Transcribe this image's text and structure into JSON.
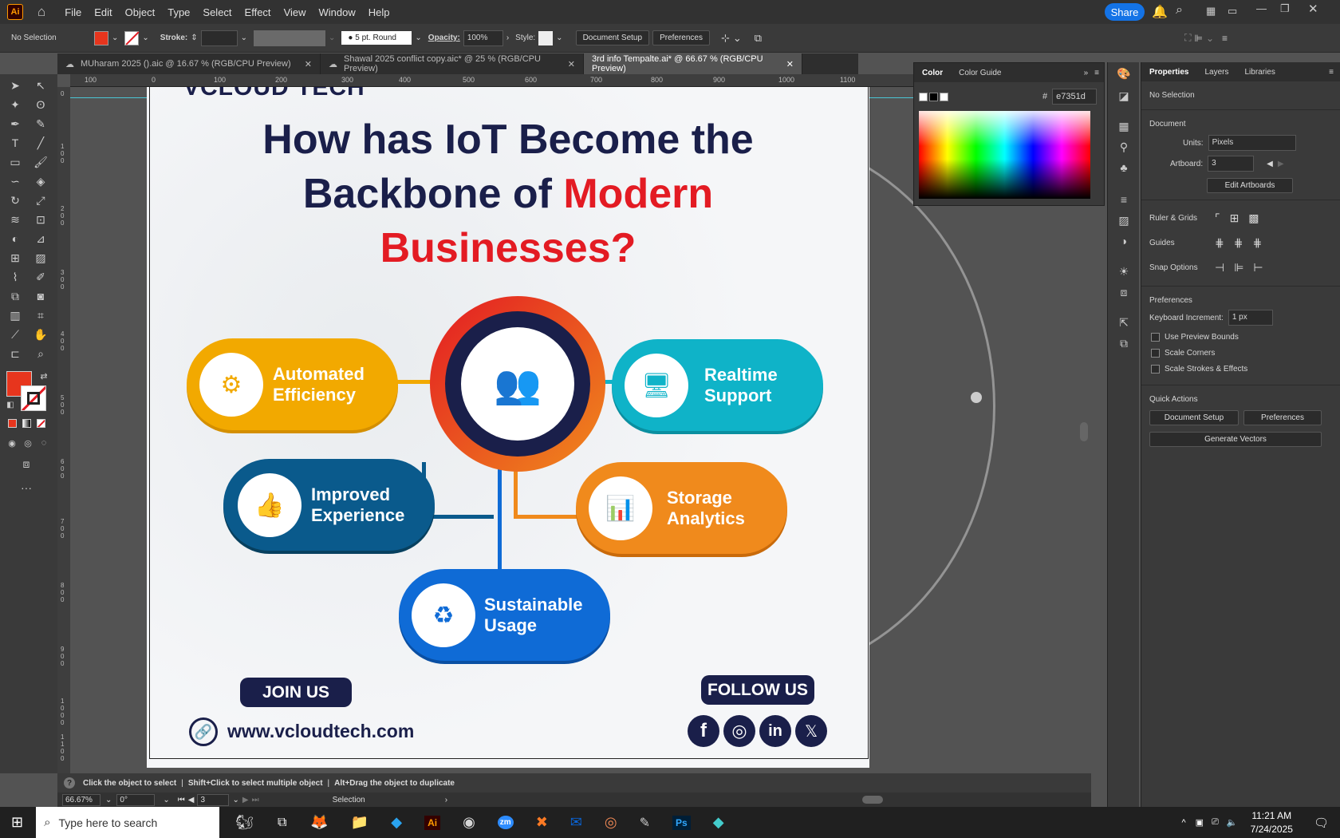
{
  "app": {
    "logo": "Ai",
    "menus": [
      "File",
      "Edit",
      "Object",
      "Type",
      "Select",
      "Effect",
      "View",
      "Window",
      "Help"
    ],
    "share": "Share"
  },
  "control": {
    "selection": "No Selection",
    "stroke_label": "Stroke:",
    "brush": "5 pt. Round",
    "opacity_label": "Opacity:",
    "opacity": "100%",
    "style_label": "Style:",
    "doc_setup": "Document Setup",
    "preferences": "Preferences"
  },
  "tabs": [
    {
      "label": "MUharam 2025 ().aic @ 16.67 % (RGB/CPU Preview)"
    },
    {
      "label": "Shawal 2025 conflict copy.aic* @ 25 % (RGB/CPU Preview)"
    },
    {
      "label": "3rd info Tempalte.ai* @ 66.67 % (RGB/CPU Preview)"
    }
  ],
  "ruler": {
    "top": [
      "100",
      "0",
      "100",
      "200",
      "300",
      "400",
      "500",
      "600",
      "700",
      "800",
      "900",
      "1000",
      "1100"
    ],
    "left": [
      "0",
      "1 0 0",
      "2 0 0",
      "3 0 0",
      "4 0 0",
      "5 0 0",
      "6 0 0",
      "7 0 0",
      "8 0 0",
      "9 0 0",
      "1 0 0 0",
      "1 1 0 0"
    ]
  },
  "artboard": {
    "logo": "VCLOUD TECH",
    "title_line1": "How has IoT Become the",
    "title_line2a": "Backbone of ",
    "title_line2b": "Modern",
    "title_line3": "Businesses?",
    "items": [
      {
        "l1": "Automated",
        "l2": "Efficiency",
        "color": "#f2a900",
        "icon": "⚙"
      },
      {
        "l1": "Realtime",
        "l2": "Support",
        "color": "#0fb3c8",
        "icon": "🖥"
      },
      {
        "l1": "Improved",
        "l2": "Experience",
        "color": "#0a5a8c",
        "icon": "👍"
      },
      {
        "l1": "Storage",
        "l2": "Analytics",
        "color": "#f08a1c",
        "icon": "📊"
      },
      {
        "l1": "Sustainable",
        "l2": "Usage",
        "color": "#0f6bd6",
        "icon": "♻"
      }
    ],
    "join": "JOIN US",
    "follow": "FOLLOW US",
    "website": "www.vcloudtech.com",
    "social": [
      "f",
      "◎",
      "in",
      "𝕏"
    ],
    "accent_red": "#e31b23",
    "navy": "#1a1f4a"
  },
  "status": {
    "hint1": "Click the object to select",
    "hint2": "Shift+Click to select multiple object",
    "hint3": "Alt+Drag the object to duplicate",
    "zoom": "66.67%",
    "rotation": "0°",
    "artboard": "3",
    "tool": "Selection"
  },
  "color_panel": {
    "tab1": "Color",
    "tab2": "Color Guide",
    "hex_label": "#",
    "hex": "e7351d"
  },
  "properties": {
    "tabs": [
      "Properties",
      "Layers",
      "Libraries"
    ],
    "no_selection": "No Selection",
    "document": "Document",
    "units_label": "Units:",
    "units": "Pixels",
    "artboard_label": "Artboard:",
    "artboard": "3",
    "edit_artboards": "Edit Artboards",
    "ruler_grids": "Ruler & Grids",
    "guides": "Guides",
    "snap": "Snap Options",
    "preferences": "Preferences",
    "keyboard_label": "Keyboard Increment:",
    "keyboard": "1 px",
    "use_preview": "Use Preview Bounds",
    "scale_corners": "Scale Corners",
    "scale_strokes": "Scale Strokes & Effects",
    "quick_actions": "Quick Actions",
    "doc_setup": "Document Setup",
    "prefs_btn": "Preferences",
    "generate": "Generate Vectors"
  },
  "taskbar": {
    "search": "Type here to search",
    "time": "11:21 AM",
    "date": "7/24/2025"
  }
}
